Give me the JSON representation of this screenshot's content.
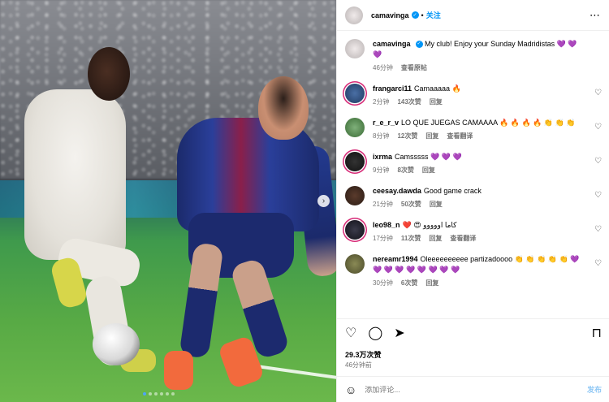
{
  "post": {
    "username": "camavinga",
    "follow_label": "关注",
    "caption": "My club! Enjoy your Sunday Madridistas 💜 💜 💜",
    "caption_time": "46分钟",
    "see_translation": "查看原帖",
    "likes": "29.3万次赞",
    "posted": "46分钟前"
  },
  "comments": [
    {
      "user": "frangarci11",
      "text": "Camaaaaa 🔥",
      "time": "2分钟",
      "likes": "143次赞",
      "reply": "回复",
      "extra": ""
    },
    {
      "user": "r_e_r_v",
      "text": "LO QUE JUEGAS CAMAAAA 🔥 🔥 🔥 🔥 👏 👏 👏",
      "time": "8分钟",
      "likes": "12次赞",
      "reply": "回复",
      "extra": "查看翻译"
    },
    {
      "user": "ixrma",
      "text": "Camsssss 💜 💜 💜",
      "time": "9分钟",
      "likes": "8次赞",
      "reply": "回复",
      "extra": ""
    },
    {
      "user": "ceesay.dawda",
      "text": "Good game crack",
      "time": "21分钟",
      "likes": "50次赞",
      "reply": "回复",
      "extra": ""
    },
    {
      "user": "leo98_n",
      "text": "❤️ 😍 كاما اووووو",
      "time": "17分钟",
      "likes": "11次赞",
      "reply": "回复",
      "extra": "查看翻译"
    },
    {
      "user": "nereamr1994",
      "text": "Oleeeeeeeeee partizadoooo 👏 👏 👏 👏 👏 💜 💜 💜 💜 💜 💜 💜 💜 💜",
      "time": "30分钟",
      "likes": "6次赞",
      "reply": "回复",
      "extra": ""
    }
  ],
  "add_comment": {
    "placeholder": "添加评论...",
    "post_label": "发布"
  },
  "icons": {
    "more": "⋯",
    "heart": "♡",
    "comment": "◯",
    "share": "➤",
    "bookmark": "⊓",
    "emoji": "☺",
    "carousel_next": "›"
  }
}
